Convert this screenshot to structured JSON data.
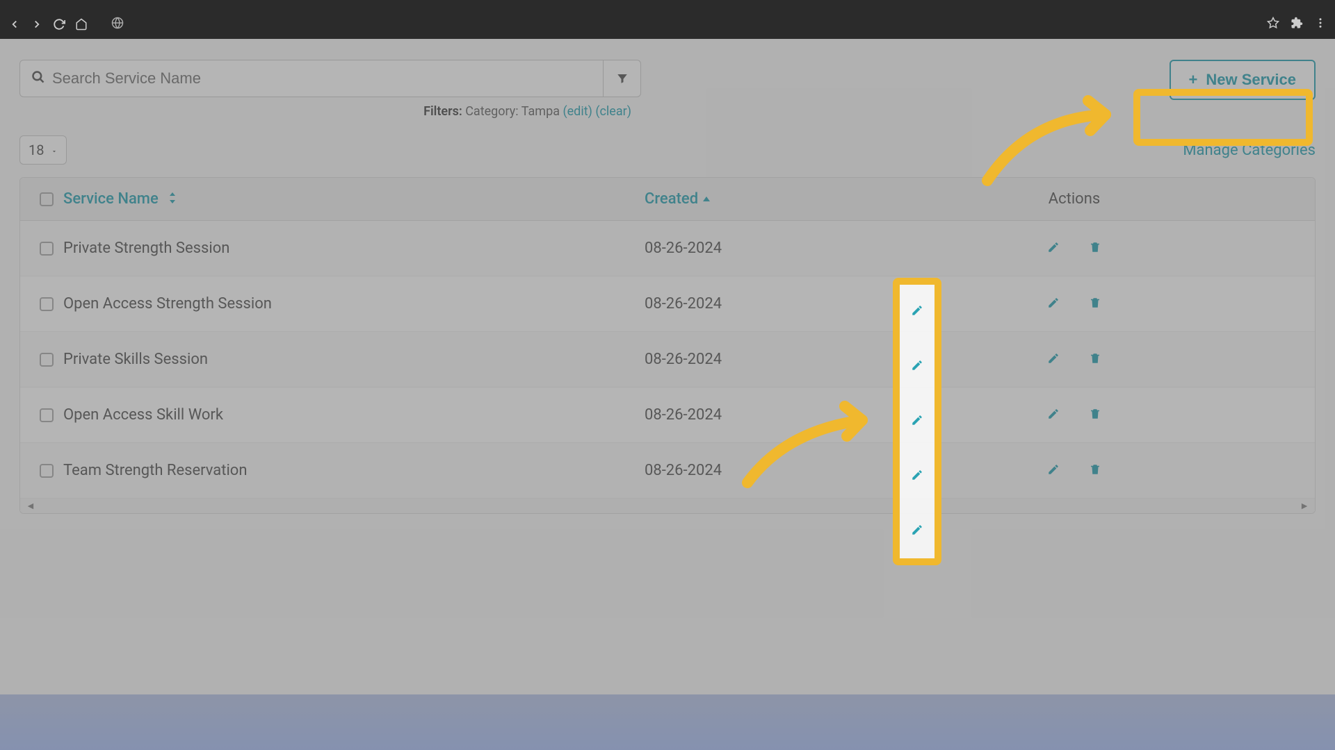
{
  "search": {
    "placeholder": "Search Service Name"
  },
  "filters": {
    "label": "Filters:",
    "text": "Category: Tampa",
    "edit": "(edit)",
    "clear": "(clear)"
  },
  "new_service_label": "New Service",
  "page_size": "18",
  "manage_categories": "Manage Categories",
  "table": {
    "headers": {
      "name": "Service Name",
      "created": "Created",
      "actions": "Actions"
    },
    "rows": [
      {
        "name": "Private Strength Session",
        "created": "08-26-2024"
      },
      {
        "name": "Open Access Strength Session",
        "created": "08-26-2024"
      },
      {
        "name": "Private Skills Session",
        "created": "08-26-2024"
      },
      {
        "name": "Open Access Skill Work",
        "created": "08-26-2024"
      },
      {
        "name": "Team Strength Reservation",
        "created": "08-26-2024"
      }
    ]
  },
  "colors": {
    "accent": "#2aa3b3",
    "highlight": "#f0b82e"
  }
}
